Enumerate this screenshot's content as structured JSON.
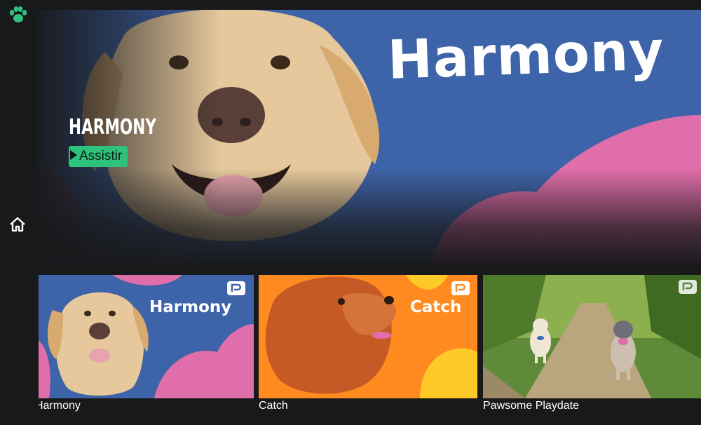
{
  "hero": {
    "brand_text": "Harmony",
    "title": "HARMONY",
    "watch_label": "Assistir"
  },
  "cards": [
    {
      "brand_text": "Harmony",
      "label": "Harmony"
    },
    {
      "brand_text": "Catch",
      "label": "Catch"
    },
    {
      "label": "Pawsome Playdate"
    }
  ],
  "colors": {
    "accent": "#2ec27e",
    "hero_bg": "#3d63a8",
    "pink": "#e06eaa",
    "orange": "#ff8a1f",
    "yellow": "#ffc928"
  },
  "icons": {
    "logo": "paw-icon",
    "home": "home-icon",
    "badge": "channel-badge-icon"
  }
}
